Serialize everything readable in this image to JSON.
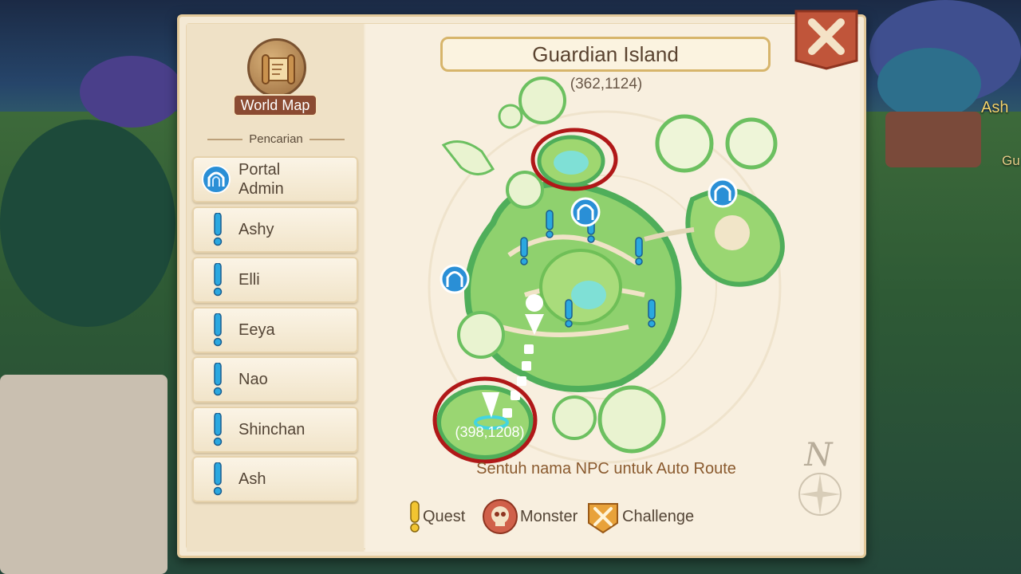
{
  "header": {
    "world_map_label": "World Map",
    "map_title": "Guardian Island",
    "player_coords": "(362,1124)"
  },
  "sidebar": {
    "search_title": "Pencarian",
    "items": [
      {
        "type": "portal",
        "label_line1": "Portal",
        "label_line2": "Admin"
      },
      {
        "type": "quest",
        "label": "Ashy"
      },
      {
        "type": "quest",
        "label": "Elli"
      },
      {
        "type": "quest",
        "label": "Eeya"
      },
      {
        "type": "quest",
        "label": "Nao"
      },
      {
        "type": "quest",
        "label": "Shinchan"
      },
      {
        "type": "quest",
        "label": "Ash"
      }
    ]
  },
  "map": {
    "destination_coords": "(398,1208)",
    "hint": "Sentuh nama NPC untuk Auto Route"
  },
  "legend": {
    "quest": "Quest",
    "monster": "Monster",
    "challenge": "Challenge"
  },
  "background": {
    "char_name_1": "Ash",
    "char_name_2": "Gu"
  },
  "colors": {
    "panel_bg": "#f4e9d4",
    "accent_brown": "#8b4b32",
    "close_red": "#c0553a",
    "quest_blue": "#2a8fd6",
    "highlight_red": "#b01818",
    "map_green": "#8fd16e"
  },
  "icons": {
    "close": "close-icon",
    "world_map": "scroll-map-icon",
    "portal": "portal-icon",
    "quest": "exclamation-icon",
    "monster": "skull-icon",
    "challenge": "crossed-swords-icon",
    "compass": "compass-icon"
  }
}
